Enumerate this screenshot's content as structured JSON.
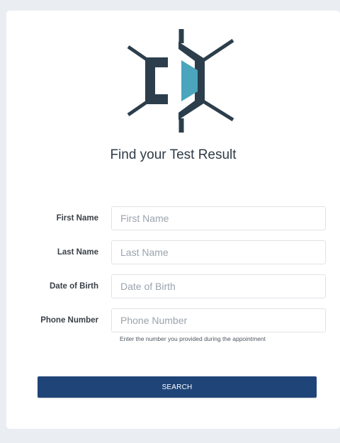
{
  "page": {
    "title": "Find your Test Result"
  },
  "logo": {
    "icon": "brackets-logo",
    "colors": {
      "dark": "#2c3e4c",
      "accent": "#4aa5bd"
    }
  },
  "form": {
    "fields": [
      {
        "label": "First Name",
        "placeholder": "First Name",
        "value": ""
      },
      {
        "label": "Last Name",
        "placeholder": "Last Name",
        "value": ""
      },
      {
        "label": "Date of Birth",
        "placeholder": "Date of Birth",
        "value": ""
      },
      {
        "label": "Phone Number",
        "placeholder": "Phone Number",
        "value": ""
      }
    ],
    "phone_hint": "Enter the number you provided during the appointment",
    "submit_label": "SEARCH"
  },
  "colors": {
    "button": "#1f4478",
    "background": "#eaedf1"
  }
}
